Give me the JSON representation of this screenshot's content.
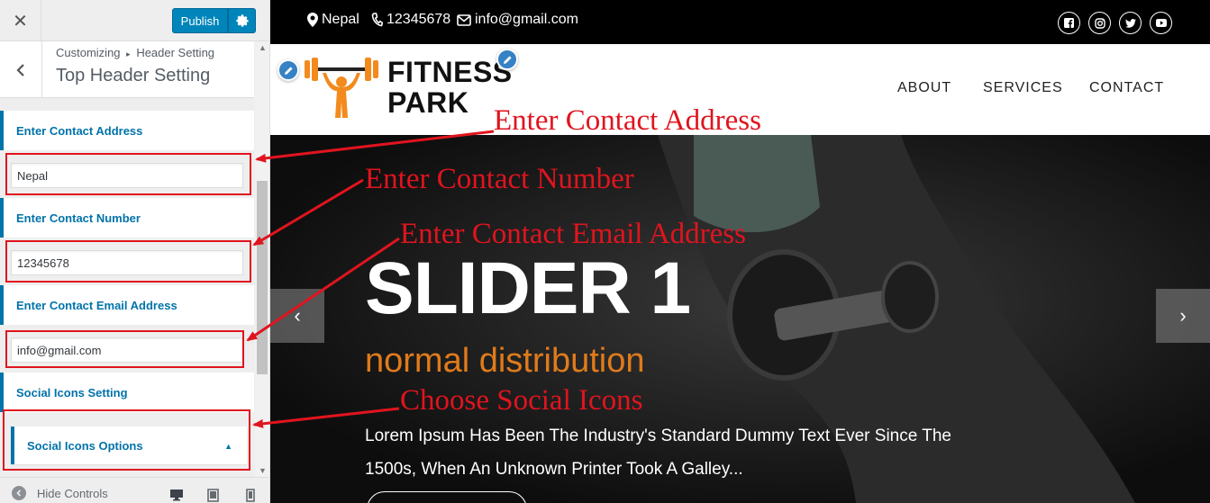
{
  "customizer": {
    "publish_label": "Publish",
    "breadcrumb_root": "Customizing",
    "breadcrumb_separator": "▸",
    "breadcrumb_parent": "Header Setting",
    "section_title": "Top Header Setting",
    "controls": [
      {
        "label": "Enter Contact Address",
        "value": "Nepal"
      },
      {
        "label": "Enter Contact Number",
        "value": "12345678"
      },
      {
        "label": "Enter Contact Email Address",
        "value": "info@gmail.com"
      }
    ],
    "social_setting_label": "Social Icons Setting",
    "social_options_label": "Social Icons Options",
    "hide_controls_label": "Hide Controls",
    "icons": [
      "close-icon",
      "gear-icon",
      "back-arrow-icon",
      "collapse-caret-icon",
      "desktop-icon",
      "tablet-icon",
      "mobile-icon"
    ]
  },
  "site": {
    "topbar": {
      "address": "Nepal",
      "phone": "12345678",
      "email": "info@gmail.com",
      "social_icons": [
        "facebook-icon",
        "instagram-icon",
        "twitter-icon",
        "youtube-icon"
      ]
    },
    "logo": {
      "line1": "FITNESS",
      "line2": "PARK",
      "colors": {
        "orange": "#f28a1e",
        "dark": "#222222"
      }
    },
    "nav": [
      "ABOUT",
      "SERVICES",
      "CONTACT"
    ],
    "slider": {
      "title": "SLIDER 1",
      "subtitle": "normal distribution",
      "description": "Lorem Ipsum Has Been The Industry's Standard Dummy Text Ever Since The 1500s, When An Unknown Printer Took A Galley...",
      "prev": "‹",
      "next": "›"
    }
  },
  "annotations": {
    "address": "Enter Contact Address",
    "number": "Enter Contact Number",
    "email": "Enter Contact Email Address",
    "social": "Choose Social Icons"
  },
  "colors": {
    "wp_blue": "#0073aa",
    "publish_blue": "#0085ba",
    "annotation_red": "#e0141e",
    "slider_orange": "#e07b1b"
  }
}
